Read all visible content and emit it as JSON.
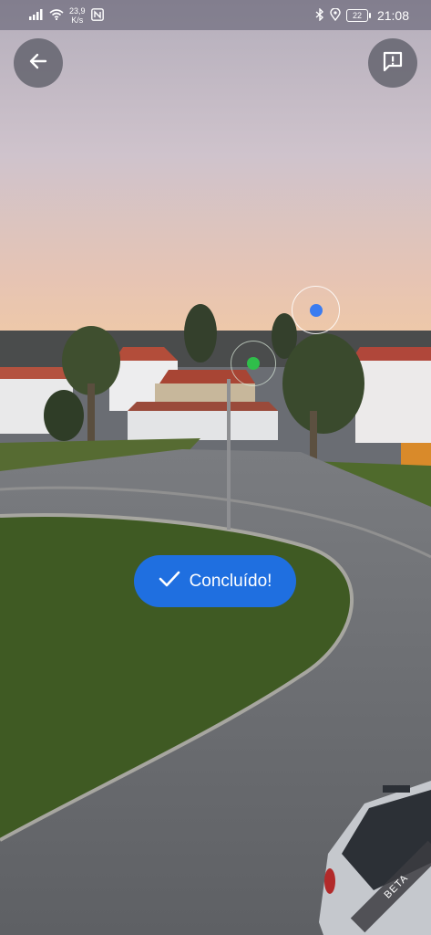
{
  "status_bar": {
    "net_speed_value": "23,9",
    "net_speed_unit": "K/s",
    "battery_level": "22",
    "time": "21:08",
    "icons": [
      "signal-icon",
      "wifi-icon",
      "nfc-icon",
      "bluetooth-icon",
      "location-icon",
      "battery-icon"
    ]
  },
  "toolbar": {
    "back_icon": "arrow-left-icon",
    "feedback_icon": "feedback-icon"
  },
  "ar_markers": [
    {
      "name": "destination",
      "color": "#3b7cf0"
    },
    {
      "name": "current-position",
      "color": "#2fbe4a"
    }
  ],
  "status_chip": {
    "icon": "check-icon",
    "label": "Concluído!",
    "color": "#1f6fe0"
  },
  "badge": {
    "label": "BETA"
  }
}
